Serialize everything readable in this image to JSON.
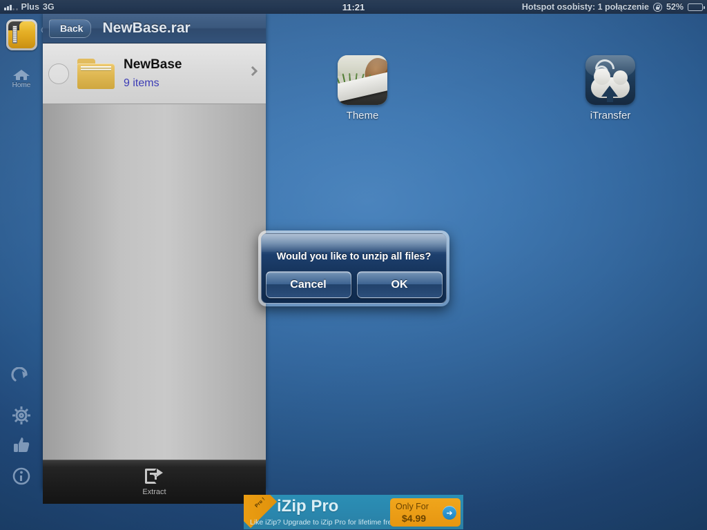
{
  "statusbar": {
    "carrier": "Plus",
    "network": "3G",
    "time": "11:21",
    "hotspot": "Hotspot osobisty: 1 połączenie",
    "battery_percent": "52%",
    "battery_level": 52,
    "signal_icon": "signal-bars-icon",
    "rotation_lock_icon": "rotation-lock-icon",
    "battery_icon": "battery-icon"
  },
  "rail": {
    "app_icon_name": "izip-app-icon",
    "items": [
      {
        "label": "Home",
        "icon": "home-icon"
      },
      {
        "label": "",
        "icon": "refresh-icon"
      },
      {
        "label": "",
        "icon": "gear-icon"
      },
      {
        "label": "",
        "icon": "thumbs-up-icon"
      },
      {
        "label": "",
        "icon": "info-icon"
      }
    ]
  },
  "panel": {
    "back_label": "Back",
    "title": "NewBase.rar",
    "rows": [
      {
        "name": "NewBase",
        "subtitle": "9 items",
        "icon": "folder-icon",
        "checked": false,
        "chevron": "chevron-right-icon"
      }
    ],
    "toolbar": {
      "extract_label": "Extract",
      "extract_icon": "export-icon"
    }
  },
  "springboard": {
    "apps": [
      {
        "label": "Theme",
        "icon": "theme-app-icon"
      },
      {
        "label": "iTransfer",
        "icon": "itransfer-app-icon"
      }
    ]
  },
  "alert": {
    "message": "Would you like to unzip all files?",
    "cancel_label": "Cancel",
    "ok_label": "OK"
  },
  "ad": {
    "ribbon": "Pro !",
    "title": "iZip Pro",
    "subtitle": "Like iZip? Upgrade to iZip Pro for lifetime free upgrade.",
    "cta_line1": "Only For",
    "cta_line2": "$4.99",
    "cta_arrow": "➔"
  },
  "colors": {
    "wallpaper_blue": "#3a70a8",
    "navbar_blue": "#3a587d",
    "link_blue": "#3b3bb5",
    "alert_blue": "#143259",
    "ad_teal": "#2a87ae",
    "ad_orange": "#e79611",
    "folder_yellow": "#dfb853"
  }
}
